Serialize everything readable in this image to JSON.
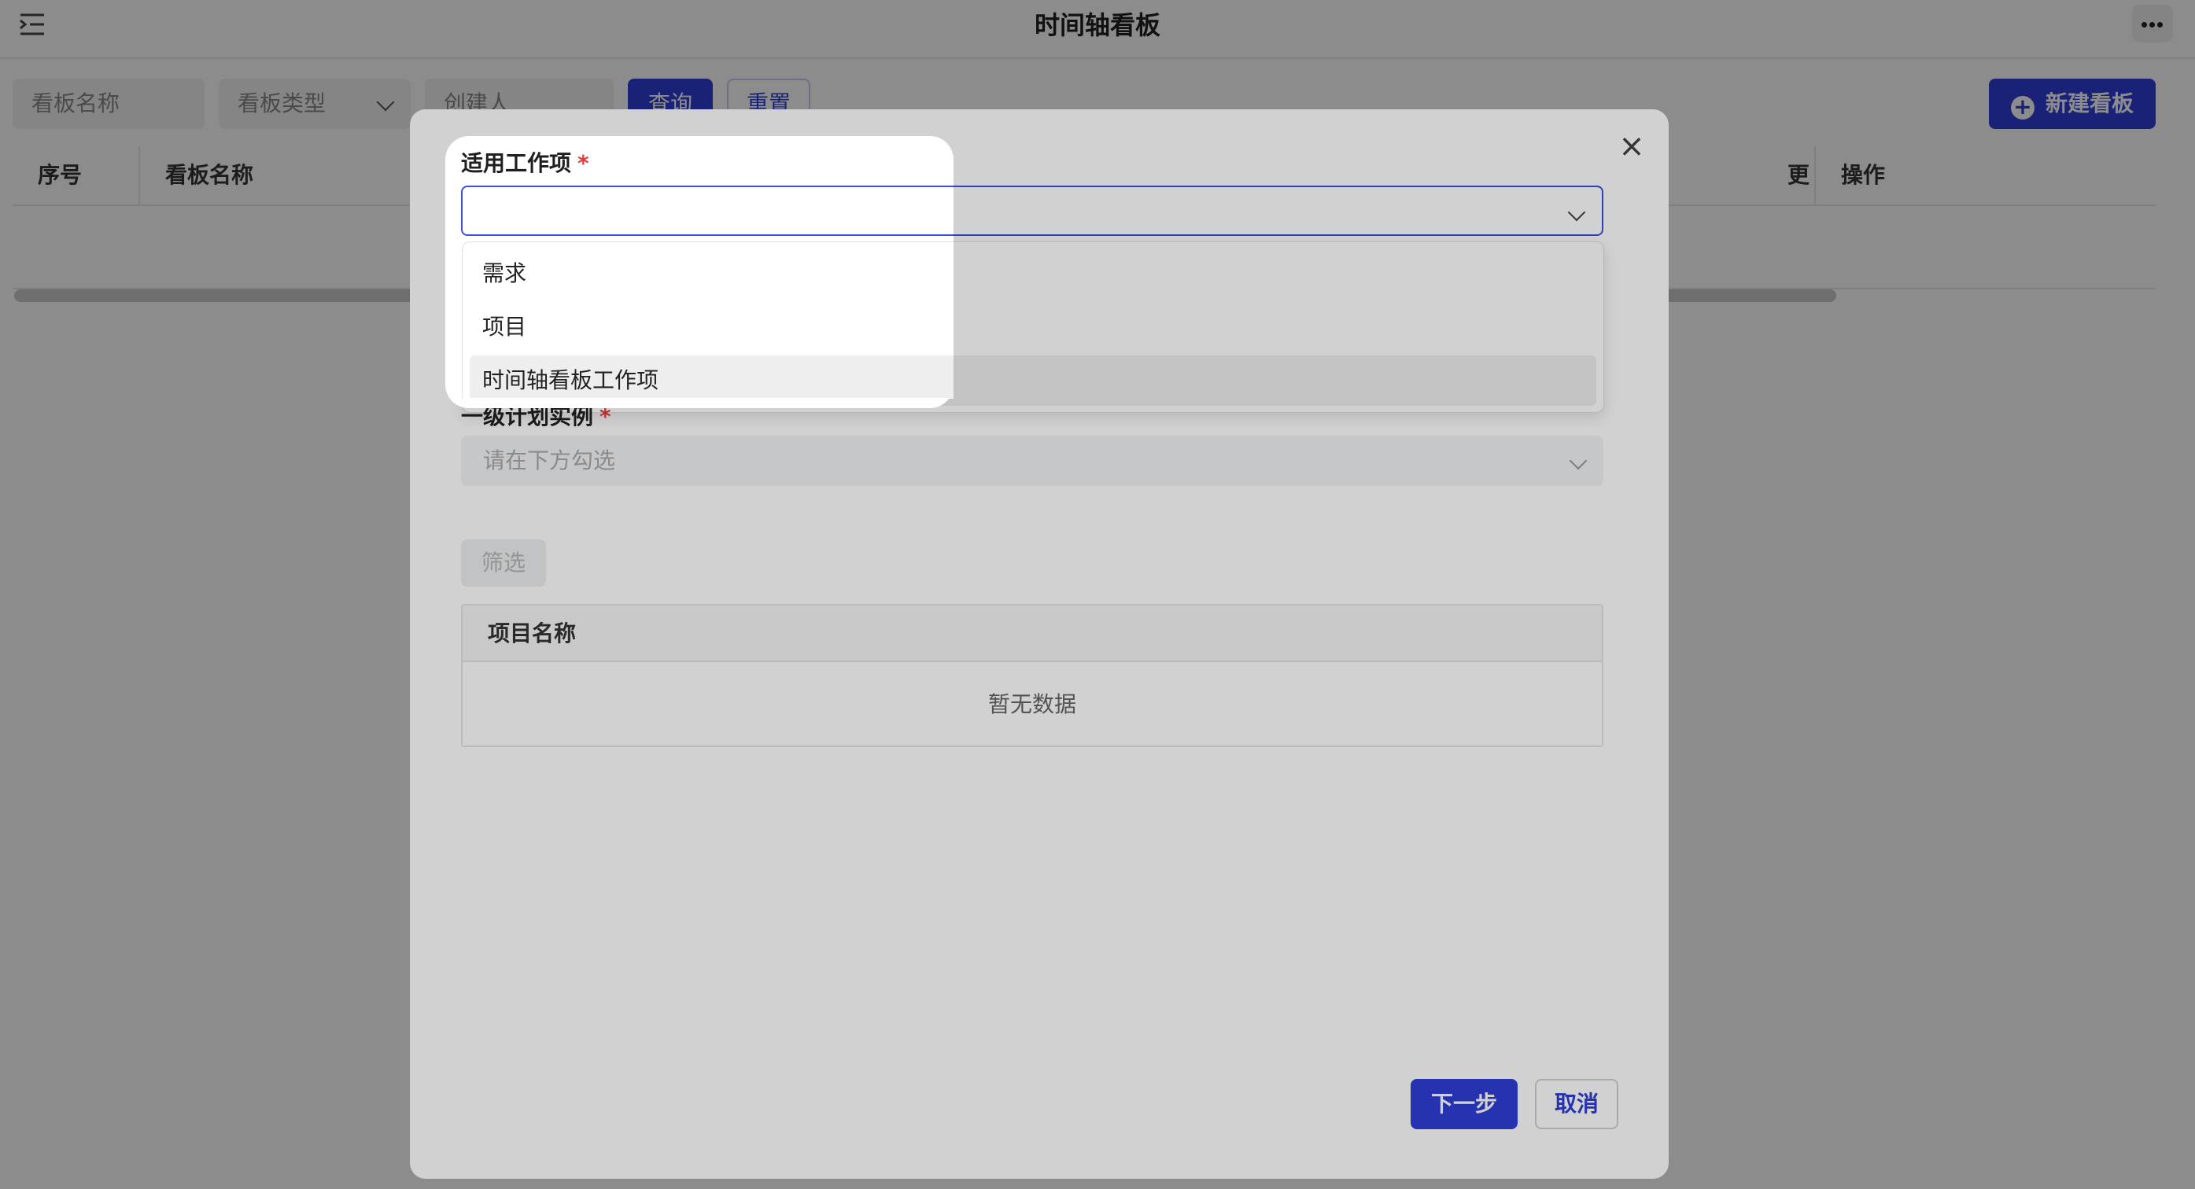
{
  "header": {
    "title": "时间轴看板",
    "menu_icon": "indent-menu-icon",
    "more_icon": "more-dots-icon"
  },
  "filters": {
    "board_name_placeholder": "看板名称",
    "board_type_placeholder": "看板类型",
    "creator_placeholder": "创建人",
    "query_label": "查询",
    "reset_label": "重置"
  },
  "new_board_label": "新建看板",
  "table": {
    "headers": {
      "index": "序号",
      "name": "看板名称",
      "updated": "更",
      "actions": "操作"
    }
  },
  "modal": {
    "work_item_label": "适用工作项",
    "required_mark": "*",
    "work_item_options": [
      "需求",
      "项目",
      "时间轴看板工作项"
    ],
    "highlighted_option": "时间轴看板工作项",
    "plan_label": "一级计划实例",
    "plan_placeholder": "请在下方勾选",
    "filter_label": "筛选",
    "project_table_header": "项目名称",
    "empty_text": "暂无数据",
    "next_label": "下一步",
    "cancel_label": "取消"
  },
  "colors": {
    "primary": "#2f3fd8",
    "required": "#e23b3b",
    "active_border": "#3d4fe0"
  }
}
